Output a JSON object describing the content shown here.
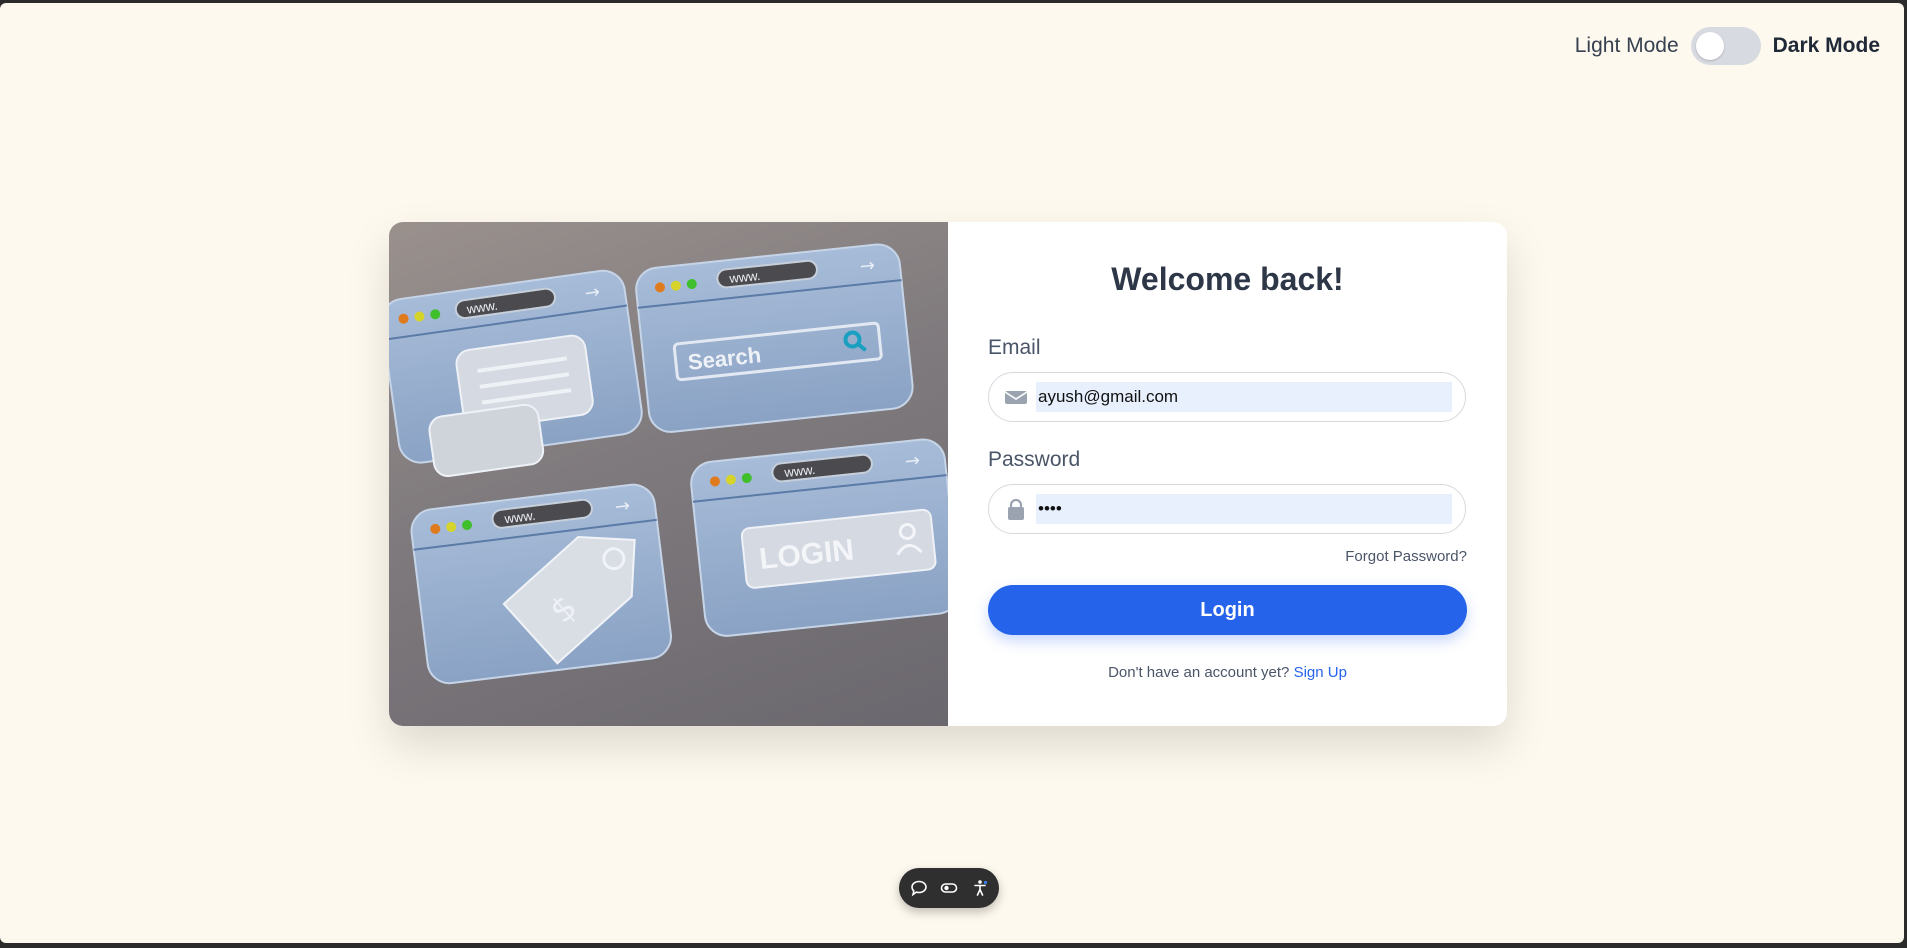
{
  "theme_toggle": {
    "light_label": "Light Mode",
    "dark_label": "Dark Mode"
  },
  "login_form": {
    "title": "Welcome back!",
    "email_label": "Email",
    "email_value": "ayush@gmail.com",
    "password_label": "Password",
    "password_value": "••••",
    "forgot_password": "Forgot Password?",
    "login_button": "Login",
    "signup_prompt": "Don't have an account yet?",
    "signup_link": "Sign Up"
  },
  "illustration": {
    "www_label": "www.",
    "search_label": "Search",
    "login_label": "LOGIN"
  },
  "colors": {
    "page_background": "#fef9ee",
    "accent": "#2563eb",
    "autofill_background": "#e8f0fe"
  },
  "icons": {
    "email": "envelope-icon",
    "password": "lock-icon",
    "toolbar": [
      "comment-icon",
      "toggle-icon",
      "accessibility-icon"
    ]
  }
}
